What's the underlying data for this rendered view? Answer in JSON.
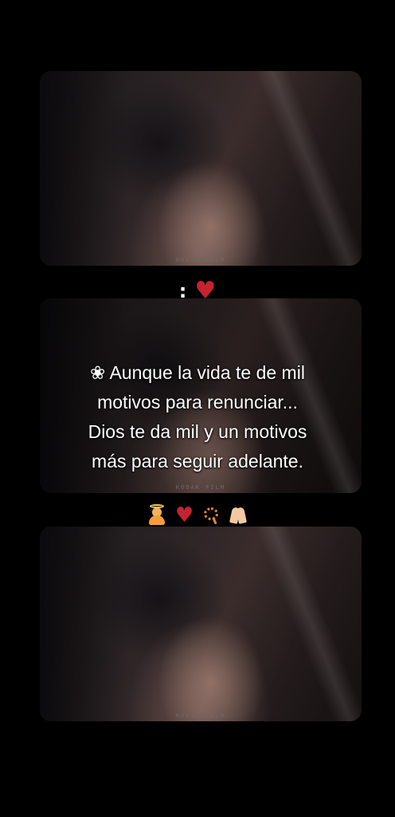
{
  "frames": [
    {
      "film_label": "KODAK FILM"
    },
    {
      "film_label": "KODAK FILM"
    },
    {
      "film_label": "KODAK FILM"
    }
  ],
  "heart_row": {
    "colon": ":",
    "icon": "anatomical-heart-icon"
  },
  "quote": {
    "flower": "❀",
    "lines": [
      "Aunque la vida te de mil",
      "motivos para renunciar...",
      "Dios te da mil y un motivos",
      "más para seguir adelante."
    ]
  },
  "icon_row": {
    "icons": [
      "praying-person-icon",
      "anatomical-heart-icon",
      "rosary-icon",
      "folded-hands-icon"
    ]
  },
  "colors": {
    "background": "#000000",
    "heart": "#c4242f",
    "text": "#ffffff"
  }
}
